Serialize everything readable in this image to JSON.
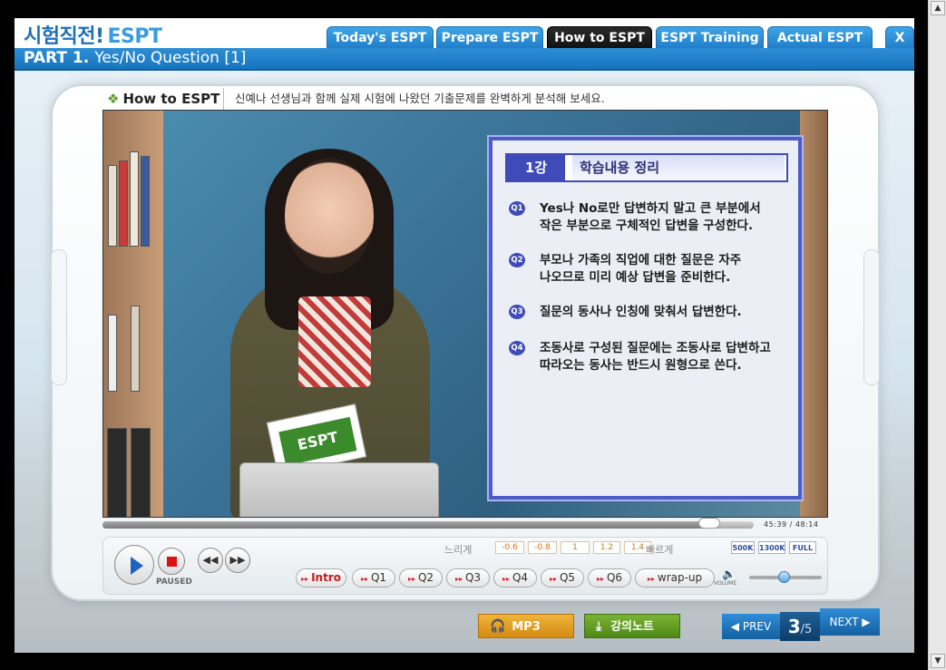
{
  "header": {
    "logo_main": "시험직전!",
    "logo_sub": "ESPT",
    "tabs": [
      {
        "label": "Today's ESPT"
      },
      {
        "label": "Prepare ESPT"
      },
      {
        "label": "How to ESPT"
      },
      {
        "label": "ESPT Training"
      },
      {
        "label": "Actual ESPT"
      },
      {
        "label": "X"
      }
    ],
    "active_tab": "How to ESPT"
  },
  "titlebar": {
    "part": "PART 1.",
    "title": "Yes/No Question [1]"
  },
  "section": {
    "label": "How to ESPT",
    "description": "신예나 선생님과 함께 실제 시험에 나왔던 기출문제를 완벽하게 분석해 보세요."
  },
  "video": {
    "book_cover": "ESPT",
    "board": {
      "lesson": "1강",
      "title": "학습내용 정리",
      "items": [
        {
          "badge": "Q1",
          "line1": "Yes나 No로만 답변하지 말고 큰 부분에서",
          "line2": "작은 부분으로 구체적인 답변을 구성한다."
        },
        {
          "badge": "Q2",
          "line1": "부모나 가족의 직업에 대한 질문은 자주",
          "line2": "나오므로 미리 예상 답변을 준비한다."
        },
        {
          "badge": "Q3",
          "line1": "질문의 동사나 인칭에 맞춰서 답변한다.",
          "line2": ""
        },
        {
          "badge": "Q4",
          "line1": "조동사로 구성된 질문에는 조동사로 답변하고",
          "line2": "따라오는 동사는 반드시 원형으로 쓴다."
        }
      ]
    }
  },
  "player": {
    "progress_fraction": 0.932,
    "time_current": "45:39",
    "time_separator": "/",
    "time_total": "48:14",
    "status": "PAUSED",
    "speed_slow_label": "느리게",
    "speed_fast_label": "빠르게",
    "speeds": [
      "-0.6",
      "-0.8",
      "1",
      "1.2",
      "1.4"
    ],
    "qualities": [
      "500K",
      "1300K",
      "FULL"
    ],
    "chapters": [
      "Intro",
      "Q1",
      "Q2",
      "Q3",
      "Q4",
      "Q5",
      "Q6",
      "wrap-up"
    ],
    "active_chapter": "Intro",
    "volume_label": "VOLUME",
    "volume_fraction": 0.48
  },
  "footer": {
    "mp3_label": "MP3",
    "note_label": "강의노트",
    "prev_label": "PREV",
    "page_current": "3",
    "page_total": "/5",
    "next_label": "NEXT"
  },
  "colors": {
    "brand_blue": "#1f6fb6",
    "tab_active": "#111111",
    "board_border": "#4f5bc6",
    "chapter_active": "#c41b1b",
    "mp3": "#d48b12",
    "note": "#4e8a17"
  },
  "icons": {
    "play": "play-icon",
    "stop": "stop-icon",
    "rewind": "rewind-icon",
    "forward": "fast-forward-icon",
    "volume": "speaker-icon",
    "mp3": "headphones-icon",
    "note": "download-icon",
    "prev": "arrow-left-icon",
    "next": "arrow-right-icon"
  }
}
